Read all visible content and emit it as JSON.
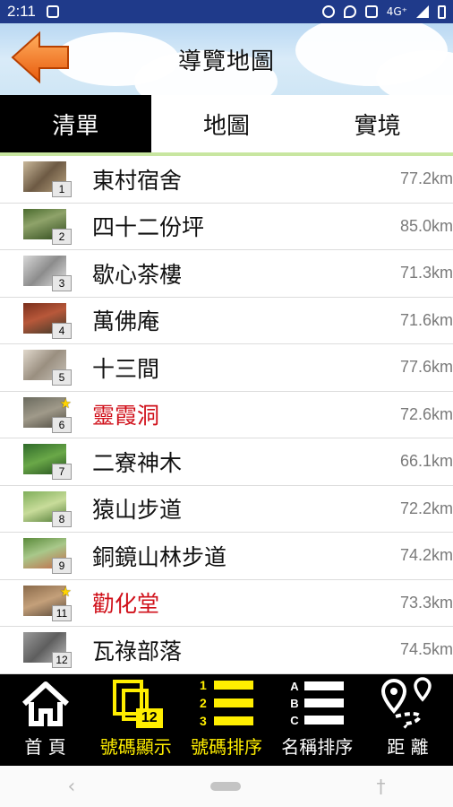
{
  "status": {
    "time": "2:11",
    "network": "4G⁺"
  },
  "header": {
    "title": "導覽地圖"
  },
  "tabs": [
    "清單",
    "地圖",
    "實境"
  ],
  "items": [
    {
      "num": "1",
      "name": "東村宿舍",
      "dist": "77.2km",
      "starred": false
    },
    {
      "num": "2",
      "name": "四十二份坪",
      "dist": "85.0km",
      "starred": false
    },
    {
      "num": "3",
      "name": "歇心茶樓",
      "dist": "71.3km",
      "starred": false
    },
    {
      "num": "4",
      "name": "萬佛庵",
      "dist": "71.6km",
      "starred": false
    },
    {
      "num": "5",
      "name": "十三間",
      "dist": "77.6km",
      "starred": false
    },
    {
      "num": "6",
      "name": "靈霞洞",
      "dist": "72.6km",
      "starred": true
    },
    {
      "num": "7",
      "name": "二寮神木",
      "dist": "66.1km",
      "starred": false
    },
    {
      "num": "8",
      "name": "猿山步道",
      "dist": "72.2km",
      "starred": false
    },
    {
      "num": "9",
      "name": "銅鏡山林步道",
      "dist": "74.2km",
      "starred": false
    },
    {
      "num": "11",
      "name": "勸化堂",
      "dist": "73.3km",
      "starred": true
    },
    {
      "num": "12",
      "name": "瓦祿部落",
      "dist": "74.5km",
      "starred": false
    }
  ],
  "bottom": {
    "home": "首 頁",
    "show_number": "號碼顯示",
    "show_number_badge": "12",
    "sort_number": "號碼排序",
    "sort_number_digits": [
      "1",
      "2",
      "3"
    ],
    "sort_name": "名稱排序",
    "sort_name_letters": [
      "A",
      "B",
      "C"
    ],
    "distance": "距 離"
  },
  "colors": {
    "status_bar": "#1f3a8a",
    "highlight_text": "#d0101a",
    "active_label": "#ffee00",
    "tab_active_bg": "#000000"
  }
}
